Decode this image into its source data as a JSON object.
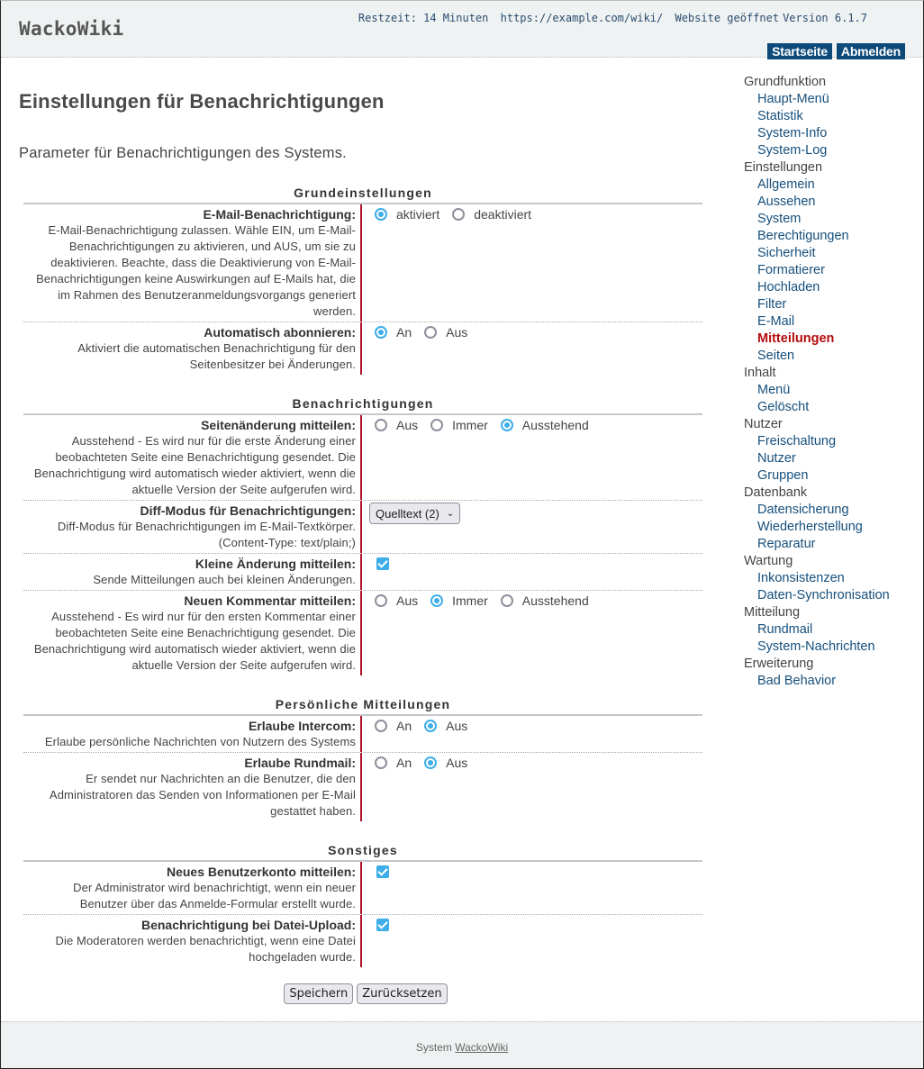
{
  "header": {
    "logo": "WackoWiki",
    "status": {
      "remaining": "Restzeit: 14 Minuten",
      "url": "https://example.com/wiki/",
      "site_state": "Website geöffnet",
      "version": "Version 6.1.7"
    },
    "nav": {
      "home": "Startseite",
      "logout": "Abmelden"
    }
  },
  "page": {
    "title": "Einstellungen für Benachrichtigungen",
    "intro": "Parameter für Benachrichtigungen des Systems."
  },
  "sections": [
    {
      "title": "Grundeinstellungen",
      "rows": [
        {
          "label": "E-Mail-Benachrichtigung:",
          "desc": "E-Mail-Benachrichtigung zulassen. Wähle EIN, um E-Mail-Benachrichtigungen zu aktivieren, und AUS, um sie zu deaktivieren. Beachte, dass die Deaktivierung von E-Mail-Benachrichtigungen keine Auswirkungen auf E-Mails hat, die im Rahmen des Benutzeranmeldungsvorgangs generiert werden.",
          "options": [
            "aktiviert",
            "deaktiviert"
          ],
          "selected": 0
        },
        {
          "label": "Automatisch abonnieren:",
          "desc": "Aktiviert die automatischen Benachrichtigung für den Seitenbesitzer bei Änderungen.",
          "options": [
            "An",
            "Aus"
          ],
          "selected": 0
        }
      ]
    },
    {
      "title": "Benachrichtigungen",
      "rows": [
        {
          "label": "Seitenänderung mitteilen:",
          "desc": "Ausstehend - Es wird nur für die erste Änderung einer beobachteten Seite eine Benachrichtigung gesendet. Die Benachrichtigung wird automatisch wieder aktiviert, wenn die aktuelle Version der Seite aufgerufen wird.",
          "options": [
            "Aus",
            "Immer",
            "Ausstehend"
          ],
          "selected": 2
        },
        {
          "label": "Diff-Modus für Benachrichtigungen:",
          "desc": "Diff-Modus für Benachrichtigungen im E-Mail-Textkörper. (Content-Type: text/plain;)",
          "select_value": "Quelltext (2)"
        },
        {
          "label": "Kleine Änderung mitteilen:",
          "desc": "Sende Mitteilungen auch bei kleinen Änderungen.",
          "checked": true
        },
        {
          "label": "Neuen Kommentar mitteilen:",
          "desc": "Ausstehend - Es wird nur für den ersten Kommentar einer beobachteten Seite eine Benachrichtigung gesendet. Die Benachrichtigung wird automatisch wieder aktiviert, wenn die aktuelle Version der Seite aufgerufen wird.",
          "options": [
            "Aus",
            "Immer",
            "Ausstehend"
          ],
          "selected": 1
        }
      ]
    },
    {
      "title": "Persönliche Mitteilungen",
      "rows": [
        {
          "label": "Erlaube Intercom:",
          "desc": "Erlaube persönliche Nachrichten von Nutzern des Systems",
          "options": [
            "An",
            "Aus"
          ],
          "selected": 1
        },
        {
          "label": "Erlaube Rundmail:",
          "desc": "Er sendet nur Nachrichten an die Benutzer, die den Administratoren das Senden von Informationen per E-Mail gestattet haben.",
          "options": [
            "An",
            "Aus"
          ],
          "selected": 1
        }
      ]
    },
    {
      "title": "Sonstiges",
      "rows": [
        {
          "label": "Neues Benutzerkonto mitteilen:",
          "desc": "Der Administrator wird benachrichtigt, wenn ein neuer Benutzer über das Anmelde-Formular erstellt wurde.",
          "checked": true
        },
        {
          "label": "Benachrichtigung bei Datei-Upload:",
          "desc": "Die Moderatoren werden benachrichtigt, wenn eine Datei hochgeladen wurde.",
          "checked": true
        }
      ]
    }
  ],
  "actions": {
    "save": "Speichern",
    "reset": "Zurücksetzen"
  },
  "sidebar": [
    {
      "group": "Grundfunktion",
      "items": [
        "Haupt-Menü",
        "Statistik",
        "System-Info",
        "System-Log"
      ]
    },
    {
      "group": "Einstellungen",
      "items": [
        "Allgemein",
        "Aussehen",
        "System",
        "Berechtigungen",
        "Sicherheit",
        "Formatierer",
        "Hochladen",
        "Filter",
        "E-Mail",
        "Mitteilungen",
        "Seiten"
      ]
    },
    {
      "group": "Inhalt",
      "items": [
        "Menü",
        "Gelöscht"
      ]
    },
    {
      "group": "Nutzer",
      "items": [
        "Freischaltung",
        "Nutzer",
        "Gruppen"
      ]
    },
    {
      "group": "Datenbank",
      "items": [
        "Datensicherung",
        "Wiederherstellung",
        "Reparatur"
      ]
    },
    {
      "group": "Wartung",
      "items": [
        "Inkonsistenzen",
        "Daten-Synchronisation"
      ]
    },
    {
      "group": "Mitteilung",
      "items": [
        "Rundmail",
        "System-Nachrichten"
      ]
    },
    {
      "group": "Erweiterung",
      "items": [
        "Bad Behavior"
      ]
    }
  ],
  "sidebar_active": "Mitteilungen",
  "footer": {
    "prefix": "System",
    "link": "WackoWiki"
  },
  "colors": {
    "accent": "#3daee9",
    "nav_bg": "#0d4a7a",
    "active_link": "#b30b0b",
    "link": "#154f7c",
    "separator": "#b0102a"
  }
}
